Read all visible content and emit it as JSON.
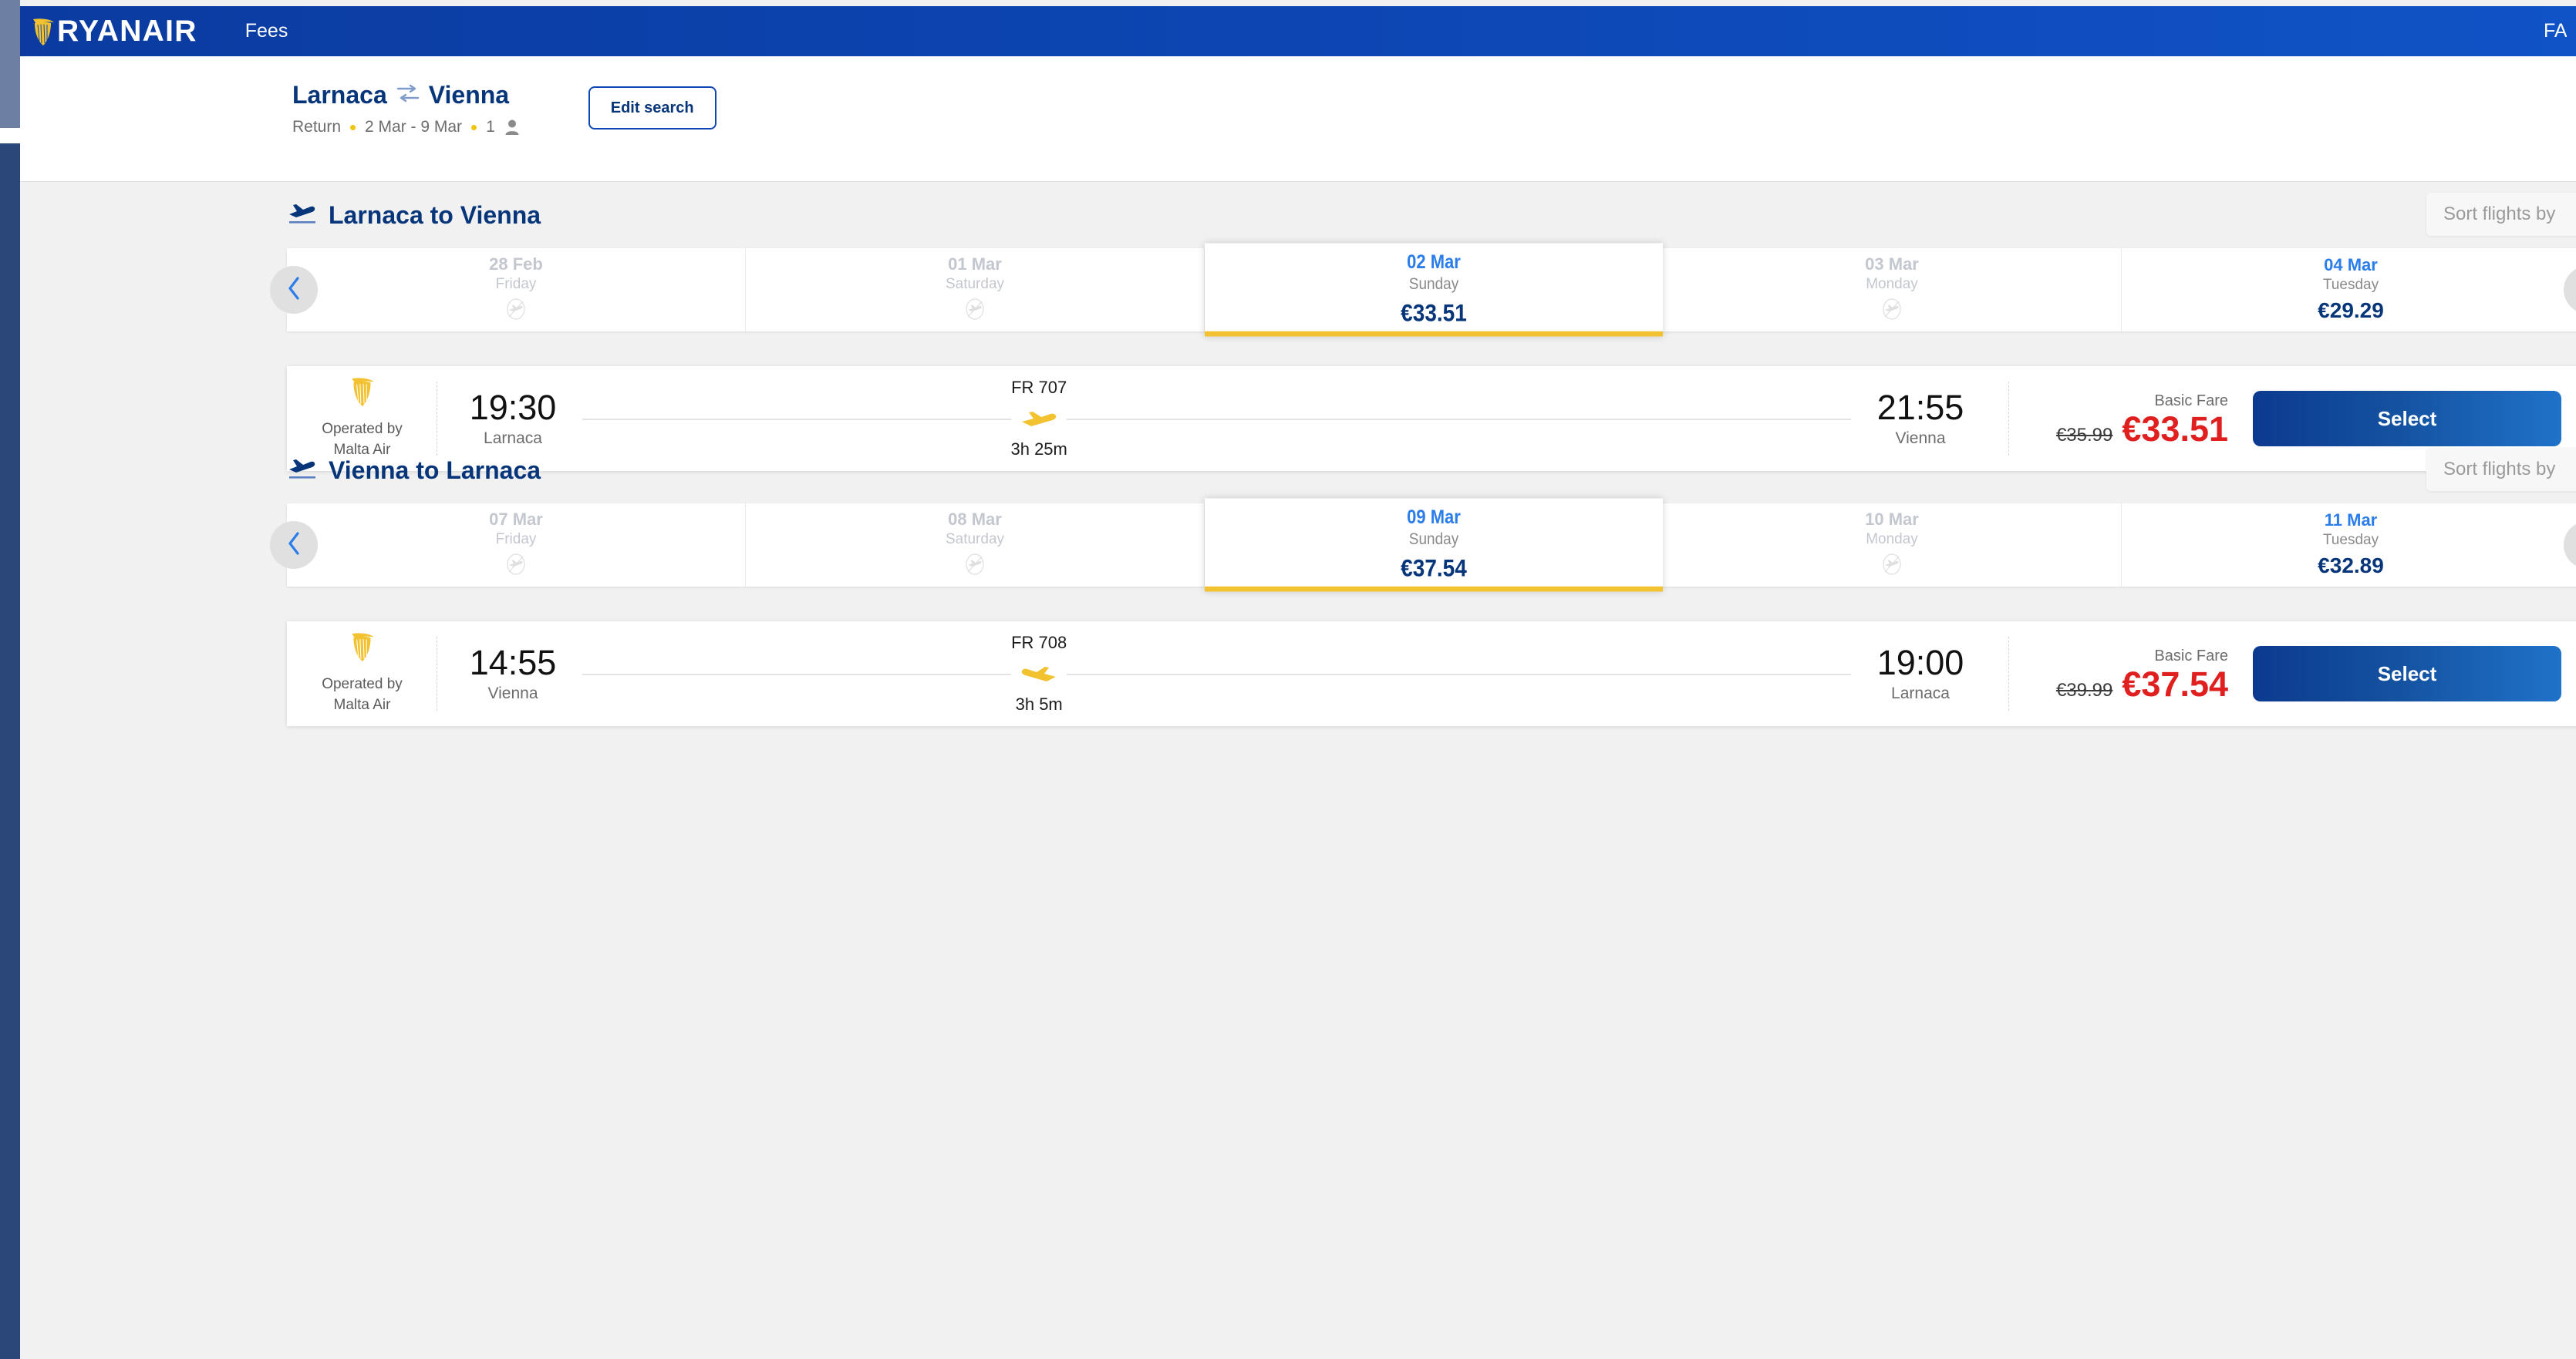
{
  "header": {
    "brand": "RYANAIR",
    "brand_icon": "ryanair-harp-icon",
    "nav_link": "Fees",
    "nav_right_truncated": "FA",
    "bg_color": "#0d47b5"
  },
  "search_summary": {
    "origin": "Larnaca",
    "destination": "Vienna",
    "route_icon": "flight-swap-icon",
    "trip_type": "Return",
    "dates": "2 Mar - 9 Mar",
    "passengers": "1",
    "passenger_icon": "person-icon",
    "edit_button": "Edit search"
  },
  "journeys": [
    {
      "id": "outbound",
      "title": "Larnaca to Vienna",
      "title_icon": "plane-departure-icon",
      "sort_label": "Sort flights by",
      "prev_arrow_icon": "chevron-left-icon",
      "next_arrow_icon": "chevron-right-icon",
      "dates": [
        {
          "date": "28 Feb",
          "day": "Friday",
          "price": "",
          "state": "disabled"
        },
        {
          "date": "01 Mar",
          "day": "Saturday",
          "price": "",
          "state": "disabled"
        },
        {
          "date": "02 Mar",
          "day": "Sunday",
          "price": "€33.51",
          "state": "selected"
        },
        {
          "date": "03 Mar",
          "day": "Monday",
          "price": "",
          "state": "disabled"
        },
        {
          "date": "04 Mar",
          "day": "Tuesday",
          "price": "€29.29",
          "state": "available"
        }
      ],
      "flight": {
        "operated_by_line1": "Operated by",
        "operated_by_line2": "Malta Air",
        "operator_icon": "ryanair-harp-icon",
        "depart_time": "19:30",
        "depart_place": "Larnaca",
        "flight_number": "FR 707",
        "duration": "3h 25m",
        "plane_icon": "plane-right-icon",
        "arrive_time": "21:55",
        "arrive_place": "Vienna",
        "fare_label": "Basic Fare",
        "price_old": "€35.99",
        "price_new": "€33.51",
        "select_label": "Select"
      }
    },
    {
      "id": "return",
      "title": "Vienna to Larnaca",
      "title_icon": "plane-departure-icon",
      "sort_label": "Sort flights by",
      "prev_arrow_icon": "chevron-left-icon",
      "next_arrow_icon": "chevron-right-icon",
      "dates": [
        {
          "date": "07 Mar",
          "day": "Friday",
          "price": "",
          "state": "disabled"
        },
        {
          "date": "08 Mar",
          "day": "Saturday",
          "price": "",
          "state": "disabled"
        },
        {
          "date": "09 Mar",
          "day": "Sunday",
          "price": "€37.54",
          "state": "selected"
        },
        {
          "date": "10 Mar",
          "day": "Monday",
          "price": "",
          "state": "disabled"
        },
        {
          "date": "11 Mar",
          "day": "Tuesday",
          "price": "€32.89",
          "state": "available"
        }
      ],
      "flight": {
        "operated_by_line1": "Operated by",
        "operated_by_line2": "Malta Air",
        "operator_icon": "ryanair-harp-icon",
        "depart_time": "14:55",
        "depart_place": "Vienna",
        "flight_number": "FR 708",
        "duration": "3h 5m",
        "plane_icon": "plane-left-icon",
        "arrive_time": "19:00",
        "arrive_place": "Larnaca",
        "fare_label": "Basic Fare",
        "price_old": "€39.99",
        "price_new": "€37.54",
        "select_label": "Select"
      }
    }
  ],
  "colors": {
    "brand_blue": "#0d47b5",
    "deep_navy": "#06357a",
    "link_blue": "#2b7de9",
    "accent_yellow": "#f2c230",
    "price_red": "#e01f1f",
    "page_bg": "#f1f1f1"
  }
}
